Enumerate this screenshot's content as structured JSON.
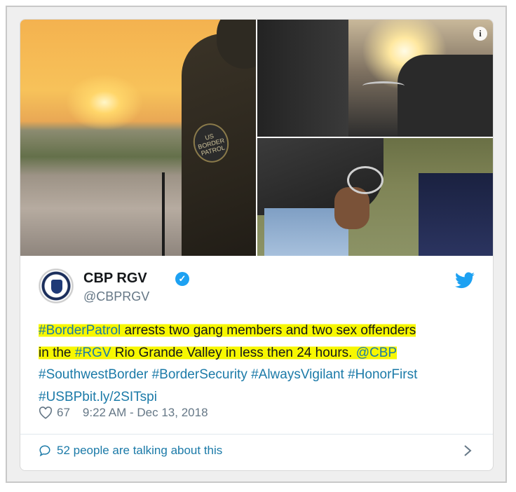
{
  "tweet": {
    "display_name": "CBP RGV",
    "handle": "@CBPRGV",
    "text_segments": {
      "l1_tag": "#BorderPatrol",
      "l1_rest": " arrests two gang members and two sex offenders",
      "l2_pre": "in the ",
      "l2_tag": "#RGV",
      "l2_mid": " Rio Grande Valley in less then 24 hours. ",
      "l2_mention": "@CBP",
      "l3": "#SouthwestBorder #BorderSecurity #AlwaysVigilant #HonorFirst",
      "l4": "#USBPbit.ly/2SITspi"
    },
    "likes": "67",
    "timestamp": "9:22 AM - Dec 13, 2018",
    "conversation": "52 people are talking about this",
    "info_badge": "i",
    "patch_text": "US BORDER PATROL"
  },
  "colors": {
    "link": "#1b7aa8",
    "highlight": "#f7f700",
    "twitter_blue": "#1da1f2"
  },
  "icons": [
    "info-icon",
    "verified-icon",
    "twitter-bird-icon",
    "heart-icon",
    "speech-bubble-icon",
    "chevron-right-icon"
  ]
}
